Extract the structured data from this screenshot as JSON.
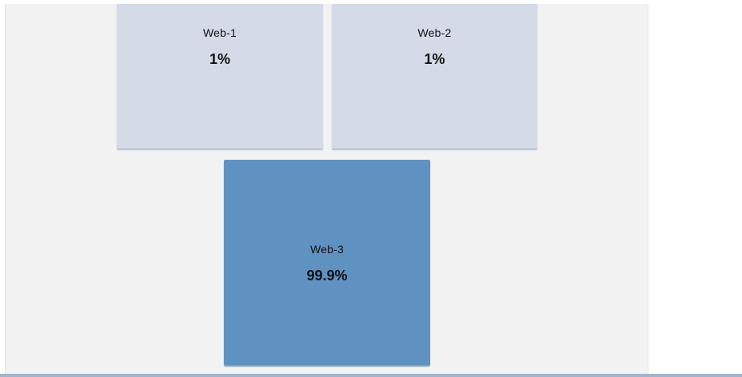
{
  "tiles": [
    {
      "name": "Web-1",
      "value": "1%",
      "style": "light"
    },
    {
      "name": "Web-2",
      "value": "1%",
      "style": "light"
    },
    {
      "name": "Web-3",
      "value": "99.9%",
      "style": "dark"
    }
  ],
  "colors": {
    "panel_background": "#f2f2f2",
    "tile_light": "#d4dae6",
    "tile_dark": "#5f92c1",
    "bottom_bar": "#9fb6cd"
  }
}
